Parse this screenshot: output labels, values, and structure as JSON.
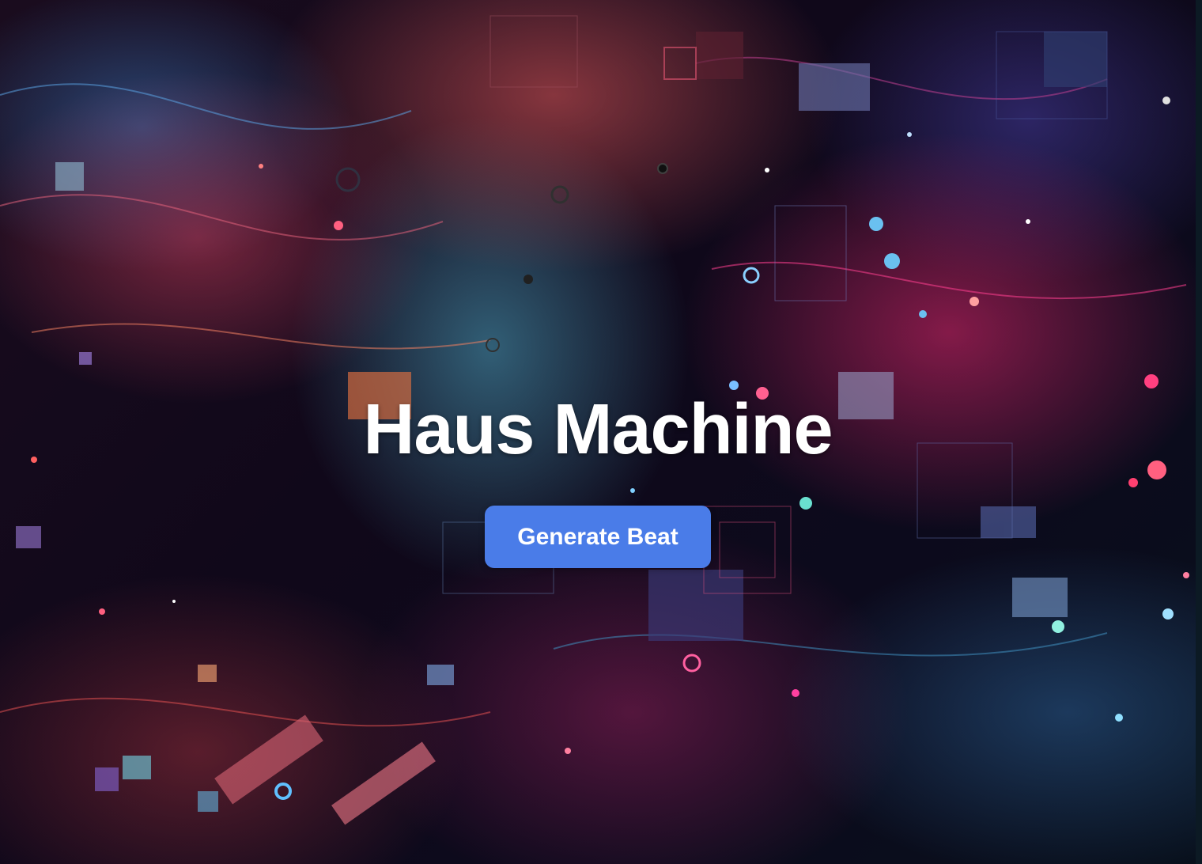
{
  "hero": {
    "title": "Haus Machine",
    "button_label": "Generate Beat"
  },
  "colors": {
    "button_bg": "#4a7ce8",
    "title_text": "#ffffff",
    "background_base": "#10081a"
  }
}
